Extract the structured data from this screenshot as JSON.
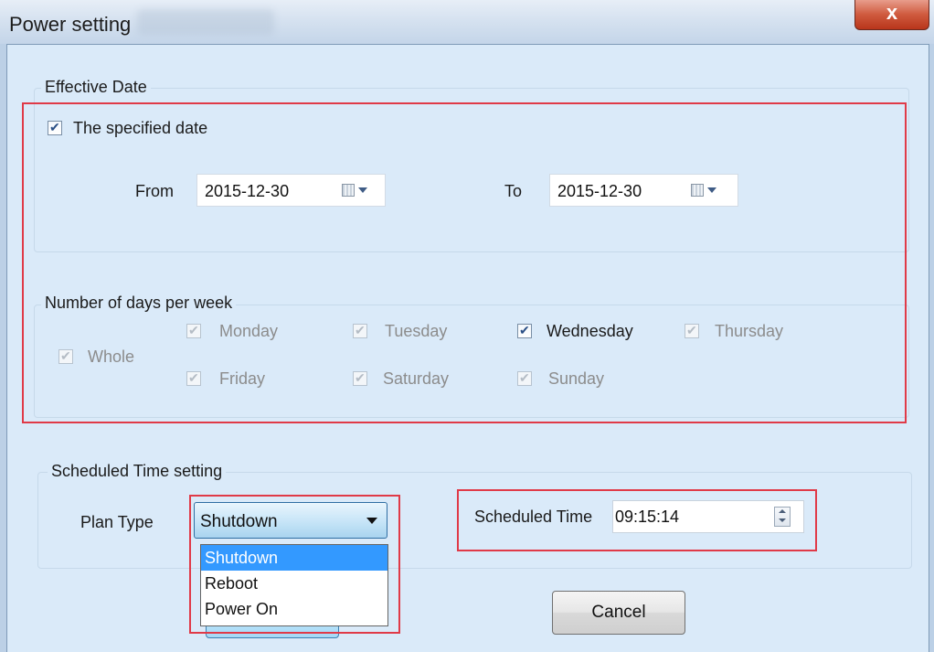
{
  "window": {
    "title": "Power setting",
    "close_label": "x"
  },
  "effective_date": {
    "legend": "Effective Date",
    "specified_date_label": "The specified date",
    "specified_date_checked": true,
    "from_label": "From",
    "from_value": "2015-12-30",
    "to_label": "To",
    "to_value": "2015-12-30"
  },
  "days_per_week": {
    "legend": "Number of days per week",
    "whole_label": "Whole",
    "days": [
      {
        "label": "Monday",
        "checked": true,
        "enabled": false
      },
      {
        "label": "Tuesday",
        "checked": true,
        "enabled": false
      },
      {
        "label": "Wednesday",
        "checked": true,
        "enabled": true
      },
      {
        "label": "Thursday",
        "checked": true,
        "enabled": false
      },
      {
        "label": "Friday",
        "checked": true,
        "enabled": false
      },
      {
        "label": "Saturday",
        "checked": true,
        "enabled": false
      },
      {
        "label": "Sunday",
        "checked": true,
        "enabled": false
      }
    ]
  },
  "scheduled": {
    "legend": "Scheduled Time setting",
    "plan_type_label": "Plan Type",
    "plan_type_value": "Shutdown",
    "plan_type_options": [
      "Shutdown",
      "Reboot",
      "Power On"
    ],
    "time_label": "Scheduled Time",
    "time_value": "09:15:14",
    "time_value_visible": "09:15:14"
  },
  "buttons": {
    "cancel_label": "Cancel"
  },
  "colors": {
    "highlight_box": "#e03a48",
    "selected_option": "#3399ff"
  }
}
